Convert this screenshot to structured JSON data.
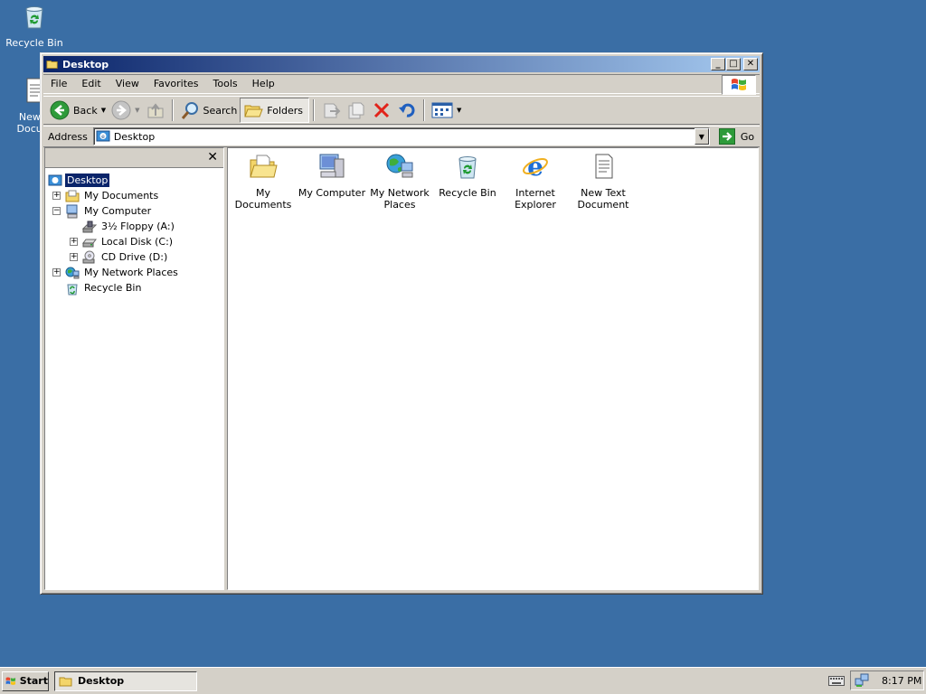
{
  "desktop": {
    "icons": [
      {
        "label": "Recycle Bin",
        "icon": "recycle-bin-icon"
      },
      {
        "label": "New T",
        "label2": "Docum",
        "icon": "text-document-icon"
      }
    ]
  },
  "window": {
    "title": "Desktop",
    "controls": {
      "minimize": "_",
      "maximize": "□",
      "close": "✕"
    }
  },
  "menubar": {
    "items": [
      "File",
      "Edit",
      "View",
      "Favorites",
      "Tools",
      "Help"
    ]
  },
  "toolbar": {
    "back_label": "Back",
    "search_label": "Search",
    "folders_label": "Folders"
  },
  "addressbar": {
    "label": "Address",
    "value": "Desktop",
    "go_label": "Go"
  },
  "folder_pane": {
    "close_glyph": "✕",
    "tree": [
      {
        "label": "Desktop",
        "icon": "desktop-icon",
        "expander": "",
        "selected": true
      },
      {
        "label": "My Documents",
        "icon": "my-documents-icon",
        "expander": "+"
      },
      {
        "label": "My Computer",
        "icon": "my-computer-icon",
        "expander": "−"
      },
      {
        "label": "3½ Floppy (A:)",
        "icon": "floppy-drive-icon",
        "expander": ""
      },
      {
        "label": "Local Disk (C:)",
        "icon": "hard-disk-icon",
        "expander": "+"
      },
      {
        "label": "CD Drive (D:)",
        "icon": "cd-drive-icon",
        "expander": "+"
      },
      {
        "label": "My Network Places",
        "icon": "network-places-icon",
        "expander": "+"
      },
      {
        "label": "Recycle Bin",
        "icon": "recycle-bin-icon",
        "expander": ""
      }
    ]
  },
  "content": {
    "items": [
      {
        "label": "My Documents",
        "icon": "my-documents-icon"
      },
      {
        "label": "My Computer",
        "icon": "my-computer-icon"
      },
      {
        "label": "My Network Places",
        "icon": "network-places-icon"
      },
      {
        "label": "Recycle Bin",
        "icon": "recycle-bin-icon"
      },
      {
        "label": "Internet Explorer",
        "icon": "internet-explorer-icon"
      },
      {
        "label": "New Text Document",
        "icon": "text-document-icon"
      }
    ]
  },
  "taskbar": {
    "start_label": "Start",
    "task_label": "Desktop",
    "clock": "8:17 PM"
  },
  "colors": {
    "desktop_bg": "#3a6ea5",
    "titlebar_start": "#0a246a",
    "titlebar_end": "#a6caf0",
    "face": "#d4d0c8",
    "selection": "#0a246a"
  }
}
